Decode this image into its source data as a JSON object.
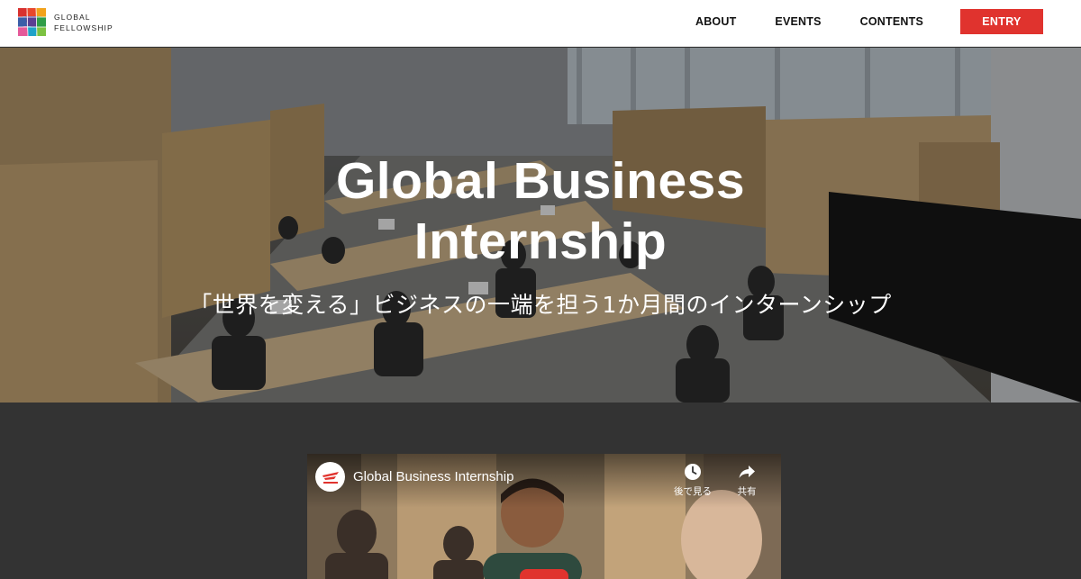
{
  "header": {
    "logo_line1": "GLOBAL",
    "logo_line2": "FELLOWSHIP",
    "nav": {
      "about": "ABOUT",
      "events": "EVENTS",
      "contents": "CONTENTS"
    },
    "entry_label": "ENTRY"
  },
  "hero": {
    "title_line1": "Global Business",
    "title_line2": "Internship",
    "subtitle": "「世界を変える」ビジネスの一端を担う1か月間のインターンシップ"
  },
  "video": {
    "title": "Global Business Internship",
    "watch_later_label": "後で見る",
    "share_label": "共有",
    "channel_icon": "channel-logo-icon"
  },
  "colors": {
    "accent": "#e0332e",
    "dark_bg": "#333333"
  }
}
